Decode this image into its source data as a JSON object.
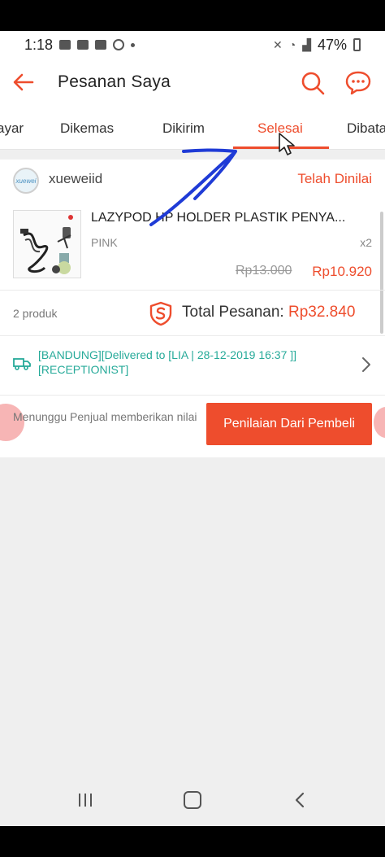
{
  "status_bar": {
    "time": "1:18",
    "battery": "47%"
  },
  "header": {
    "title": "Pesanan Saya"
  },
  "tabs": [
    {
      "label": "ayar",
      "active": false
    },
    {
      "label": "Dikemas",
      "active": false
    },
    {
      "label": "Dikirim",
      "active": false
    },
    {
      "label": "Selesai",
      "active": true
    },
    {
      "label": "Dibata",
      "active": false
    }
  ],
  "order": {
    "shop_name": "xueweiid",
    "shop_avatar_text": "xuewei",
    "status": "Telah Dinilai",
    "product": {
      "name": "LAZYPOD HP HOLDER PLASTIK PENYA...",
      "variant": "PINK",
      "quantity": "x2",
      "original_price": "Rp13.000",
      "price": "Rp10.920"
    },
    "product_count": "2 produk",
    "total_label": "Total Pesanan:",
    "total_value": "Rp32.840",
    "shipping_status": "[BANDUNG][Delivered to [LIA | 28-12-2019 16:37 ]] [RECEPTIONIST]",
    "waiting_text": "Menunggu Penjual memberikan nilai",
    "action_button": "Penilaian Dari Pembeli"
  },
  "colors": {
    "accent": "#ee4d2d",
    "shipping_text": "#26aa99",
    "annotation_arrow": "#1f3bd6"
  }
}
